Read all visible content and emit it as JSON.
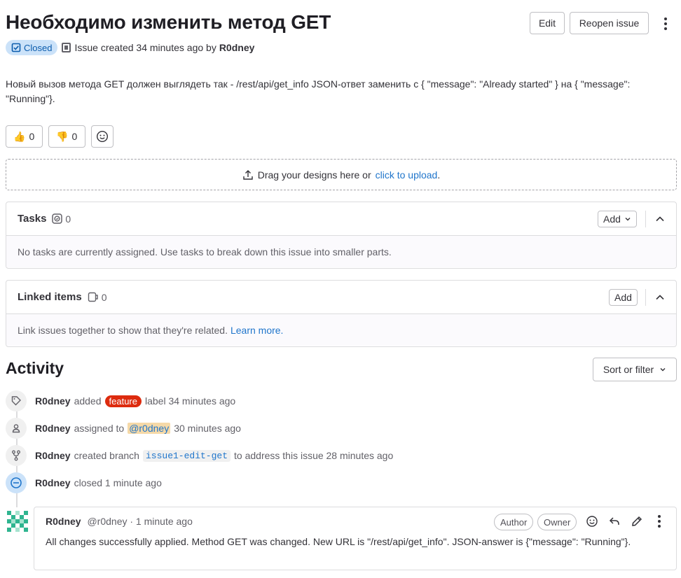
{
  "issue": {
    "title": "Необходимо изменить метод GET",
    "status": "Closed",
    "meta_prefix": "Issue created 34 minutes ago by",
    "author": "R0dney",
    "description": "Новый вызов метода GET должен выглядеть так - /rest/api/get_info JSON-ответ заменить с { \"message\": \"Already started\" } на { \"message\": \"Running\"}."
  },
  "header": {
    "edit_label": "Edit",
    "reopen_label": "Reopen issue"
  },
  "reactions": {
    "thumbsup_count": "0",
    "thumbsdown_count": "0"
  },
  "designs": {
    "text": "Drag your designs here or",
    "link": "click to upload",
    "suffix": "."
  },
  "tasks": {
    "title": "Tasks",
    "count": "0",
    "add_label": "Add",
    "empty_text": "No tasks are currently assigned. Use tasks to break down this issue into smaller parts."
  },
  "linked": {
    "title": "Linked items",
    "count": "0",
    "add_label": "Add",
    "empty_text": "Link issues together to show that they're related.",
    "learn_more": "Learn more."
  },
  "activity": {
    "title": "Activity",
    "sort_label": "Sort or filter",
    "events": [
      {
        "author": "R0dney",
        "pre": "added",
        "label": "feature",
        "post": "label 34 minutes ago"
      },
      {
        "author": "R0dney",
        "pre": "assigned to",
        "mention": "@r0dney",
        "post": "30 minutes ago"
      },
      {
        "author": "R0dney",
        "pre": "created branch",
        "branch": "issue1-edit-get",
        "post": "to address this issue 28 minutes ago"
      },
      {
        "author": "R0dney",
        "pre": "closed 1 minute ago"
      }
    ]
  },
  "comment": {
    "author": "R0dney",
    "handle_time": "@r0dney · 1 minute ago",
    "badge_author": "Author",
    "badge_owner": "Owner",
    "body": "All changes successfully applied. Method GET was changed. New URL is \"/rest/api/get_info\". JSON-answer is {\"message\": \"Running\"}."
  },
  "colors": {
    "accent": "#1f75cb",
    "closed_bg": "#cbe2f9",
    "label_feature": "#dd2b0e"
  }
}
